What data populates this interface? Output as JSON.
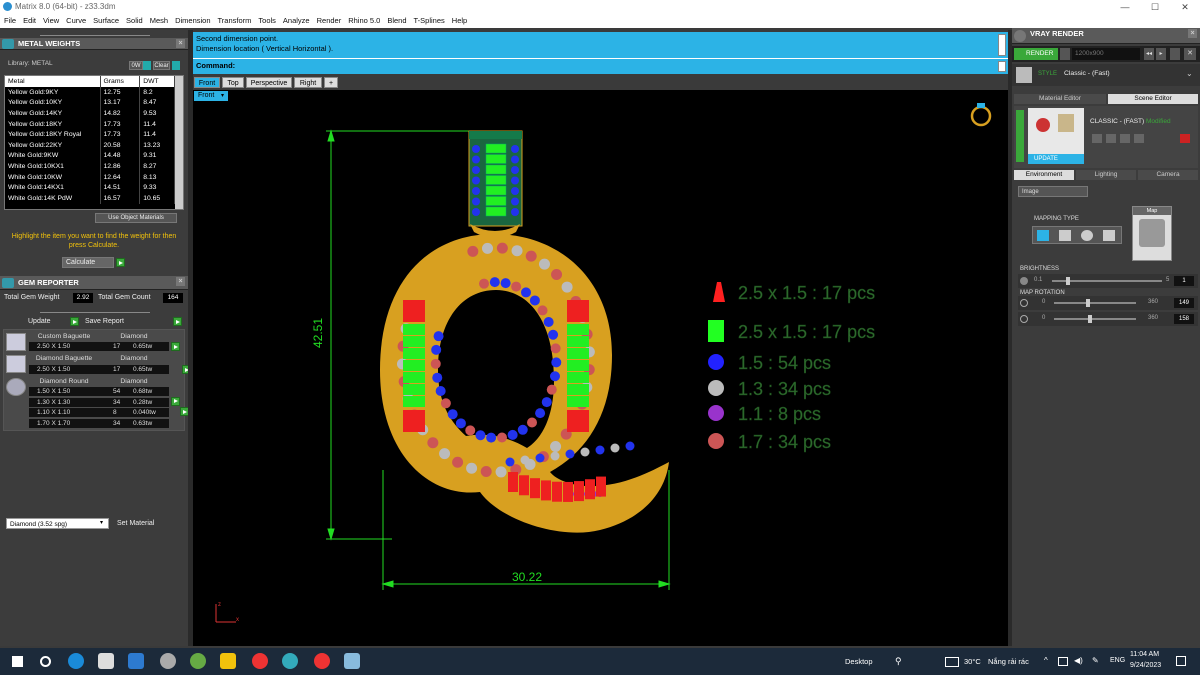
{
  "window": {
    "title": "Matrix 8.0 (64-bit) - z33.3dm",
    "min": "—",
    "max": "☐",
    "close": "✕"
  },
  "menu": [
    "File",
    "Edit",
    "View",
    "Curve",
    "Surface",
    "Solid",
    "Mesh",
    "Dimension",
    "Transform",
    "Tools",
    "Analyze",
    "Render",
    "Rhino 5.0",
    "Blend",
    "T-Splines",
    "Help"
  ],
  "metal": {
    "title": "METAL WEIGHTS",
    "library": "Library: METAL",
    "unit": "0W",
    "clear": "Clear",
    "headers": [
      "Metal",
      "Grams",
      "DWT"
    ],
    "rows": [
      [
        "Yellow Gold:9KY",
        "12.75",
        "8.2"
      ],
      [
        "Yellow Gold:10KY",
        "13.17",
        "8.47"
      ],
      [
        "Yellow Gold:14KY",
        "14.82",
        "9.53"
      ],
      [
        "Yellow Gold:18KY",
        "17.73",
        "11.4"
      ],
      [
        "Yellow Gold:18KY Royal",
        "17.73",
        "11.4"
      ],
      [
        "Yellow Gold:22KY",
        "20.58",
        "13.23"
      ],
      [
        "White Gold:9KW",
        "14.48",
        "9.31"
      ],
      [
        "White Gold:10KX1",
        "12.86",
        "8.27"
      ],
      [
        "White Gold:10KW",
        "12.64",
        "8.13"
      ],
      [
        "White Gold:14KX1",
        "14.51",
        "9.33"
      ],
      [
        "White Gold:14K PdW",
        "16.57",
        "10.65"
      ]
    ],
    "use_object": "Use Object Materials",
    "hint": "Highlight the item you want to find the weight for then press Calculate.",
    "calculate": "Calculate"
  },
  "gem": {
    "title": "GEM REPORTER",
    "total_weight_label": "Total Gem Weight",
    "total_weight": "2.92",
    "total_count_label": "Total Gem Count",
    "total_count": "164",
    "update": "Update",
    "save": "Save Report",
    "groups": [
      {
        "name": "Custom Baguette",
        "material": "Diamond",
        "rows": [
          [
            "2.50 X 1.50",
            "17",
            "0.65tw"
          ]
        ]
      },
      {
        "name": "Diamond Baguette",
        "material": "Diamond",
        "rows": [
          [
            "2.50 X 1.50",
            "17",
            "0.65tw"
          ]
        ]
      },
      {
        "name": "Diamond Round",
        "material": "Diamond",
        "rows": [
          [
            "1.50 X 1.50",
            "54",
            "0.68tw"
          ],
          [
            "1.30 X 1.30",
            "34",
            "0.28tw"
          ],
          [
            "1.10 X 1.10",
            "8",
            "0.040tw"
          ],
          [
            "1.70 X 1.70",
            "34",
            "0.63tw"
          ]
        ]
      }
    ],
    "material_select": "Diamond     (3.52 spg)",
    "set_material": "Set Material"
  },
  "command": {
    "line1": "Second dimension point.",
    "line2": "Dimension location ( Vertical  Horizontal ).",
    "label": "Command:"
  },
  "tabs": [
    "Front",
    "Top",
    "Perspective",
    "Right",
    "+"
  ],
  "viewport_label": "Front",
  "dims": {
    "height": "42.51",
    "width": "30.22"
  },
  "legend": [
    {
      "text": "2.5 x 1.5 : 17 pcs",
      "color": "#ff2020",
      "shape": "trap"
    },
    {
      "text": "2.5 x 1.5 : 17 pcs",
      "color": "#22ff22",
      "shape": "rect"
    },
    {
      "text": "1.5 : 54 pcs",
      "color": "#2222ff",
      "shape": "dot"
    },
    {
      "text": "1.3 : 34 pcs",
      "color": "#bbbbbb",
      "shape": "dot"
    },
    {
      "text": "1.1 : 8 pcs",
      "color": "#9933cc",
      "shape": "dot"
    },
    {
      "text": "1.7 : 34 pcs",
      "color": "#cc5555",
      "shape": "dot"
    }
  ],
  "vray": {
    "title": "VRAY RENDER",
    "render": "RENDER",
    "size": "1200x900",
    "style_label": "STYLE",
    "style": "Classic - (Fast)",
    "tab_material": "Material Editor",
    "tab_scene": "Scene Editor",
    "preset": "CLASSIC - (FAST)",
    "modified": "Modified",
    "update": "UPDATE",
    "subtabs": [
      "Environment",
      "Lighting",
      "Camera"
    ],
    "env_select": "Image",
    "mapping_type": "MAPPING TYPE",
    "map": "Map",
    "brightness": "BRIGHTNESS",
    "b_min": "0.1",
    "b_max": "5",
    "b_val": "1",
    "map_rotation": "MAP ROTATION",
    "r1_min": "0",
    "r1_max": "360",
    "r1_val": "149",
    "r2_min": "0",
    "r2_max": "360",
    "r2_val": "158"
  },
  "taskbar": {
    "desktop": "Desktop",
    "temp": "30°C",
    "weather": "Nắng rải rác",
    "lang": "ENG",
    "time": "11:04 AM",
    "date": "9/24/2023"
  }
}
